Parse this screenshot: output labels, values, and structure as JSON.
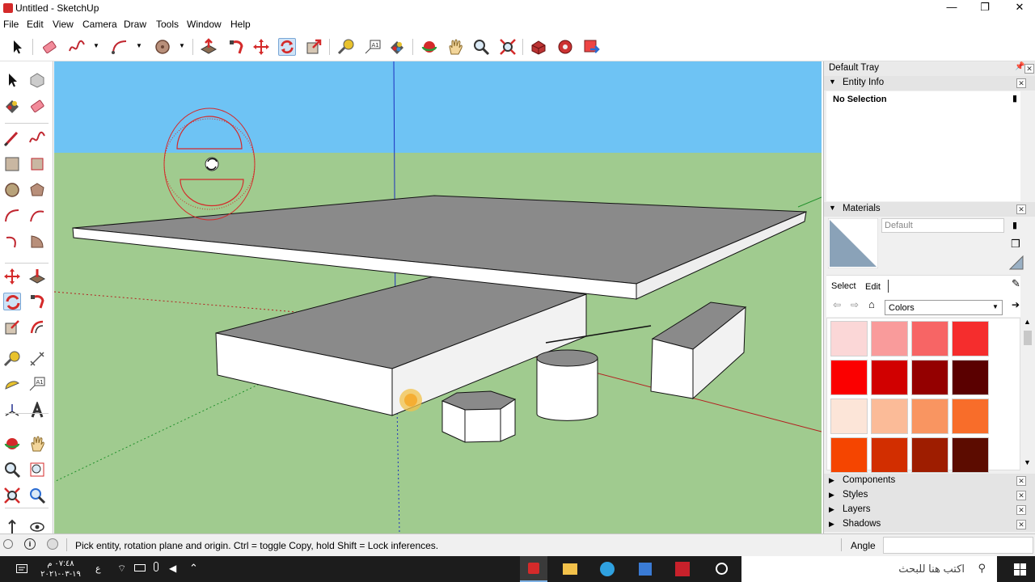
{
  "window": {
    "title": "Untitled - SketchUp",
    "minimize": "—",
    "restore": "❐",
    "close": "✕"
  },
  "menu": [
    "File",
    "Edit",
    "View",
    "Camera",
    "Draw",
    "Tools",
    "Window",
    "Help"
  ],
  "tray": {
    "title": "Default Tray",
    "entity_info": {
      "header": "Entity Info",
      "selection": "No Selection"
    },
    "materials": {
      "header": "Materials",
      "material_name": "Default",
      "tabs": {
        "select": "Select",
        "edit": "Edit"
      },
      "library": "Colors",
      "swatches": [
        "#fbd7d7",
        "#f99b9b",
        "#f76565",
        "#f52d2d",
        "#fb0000",
        "#d10000",
        "#940000",
        "#5a0000",
        "#fce5d8",
        "#fbbb98",
        "#f99561",
        "#f86d2a",
        "#f54500",
        "#d22e00",
        "#9e1d00",
        "#5c0c00"
      ]
    },
    "collapsed_panels": [
      "Components",
      "Styles",
      "Layers",
      "Shadows"
    ]
  },
  "status": {
    "hint": "Pick entity, rotation plane and origin.  Ctrl = toggle Copy, hold Shift = Lock inferences.",
    "measurement_label": "Angle",
    "measurement_value": ""
  },
  "taskbar": {
    "time": "٠٧:٤٨ م",
    "date": "١٩-٠٣-٢٠٢١",
    "search_placeholder": "اكتب هنا للبحث",
    "lang": "ع"
  },
  "colors": {
    "sky": "#6ec3f4",
    "ground": "#a0cb8f",
    "top_face": "#8a8a8a",
    "side_face": "#ffffff",
    "accent": "#d42a2a"
  }
}
